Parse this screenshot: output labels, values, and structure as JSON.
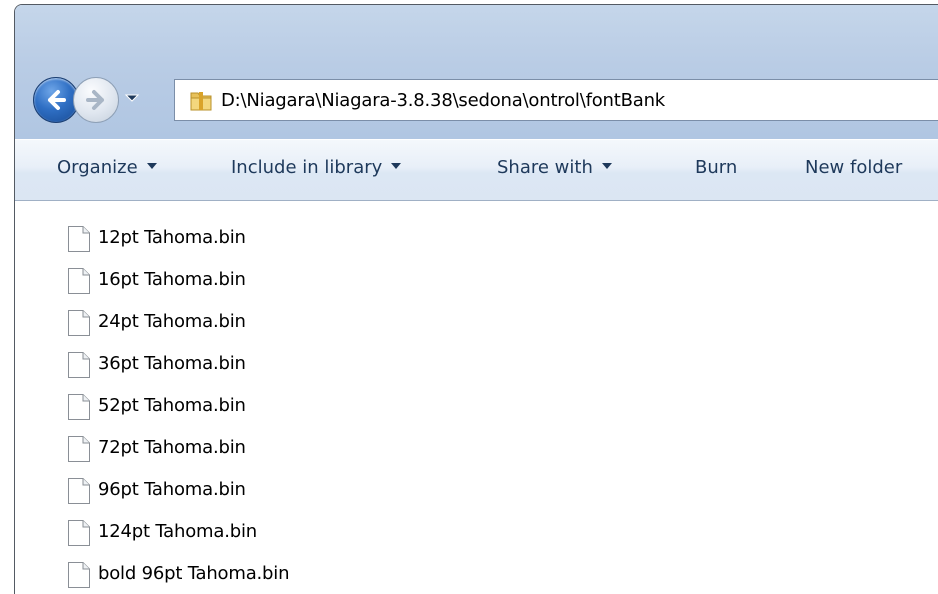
{
  "address_bar": {
    "path": "D:\\Niagara\\Niagara-3.8.38\\sedona\\ontrol\\fontBank"
  },
  "toolbar": {
    "organize": "Organize",
    "include_in_library": "Include in library",
    "share_with": "Share with",
    "burn": "Burn",
    "new_folder": "New folder"
  },
  "files": [
    {
      "name": "12pt Tahoma.bin"
    },
    {
      "name": "16pt Tahoma.bin"
    },
    {
      "name": "24pt Tahoma.bin"
    },
    {
      "name": "36pt Tahoma.bin"
    },
    {
      "name": "52pt Tahoma.bin"
    },
    {
      "name": "72pt Tahoma.bin"
    },
    {
      "name": "96pt Tahoma.bin"
    },
    {
      "name": "124pt Tahoma.bin"
    },
    {
      "name": "bold 96pt Tahoma.bin"
    }
  ],
  "icons": {
    "back": "back-arrow-icon",
    "forward": "forward-arrow-icon",
    "history": "chevron-down-icon",
    "folder": "folder-icon",
    "file": "file-icon"
  },
  "colors": {
    "back_button": "#2f6fc4",
    "command_text": "#1e395b",
    "chrome": "#b9cce5"
  }
}
